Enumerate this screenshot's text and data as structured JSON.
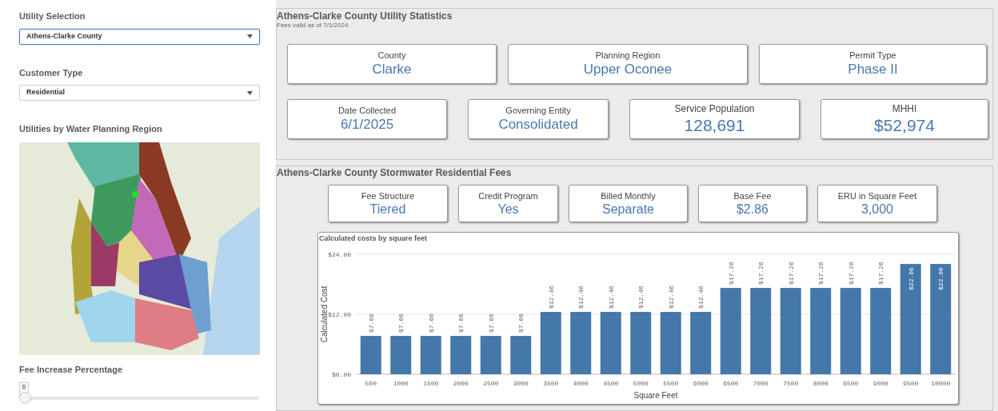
{
  "sidebar": {
    "filters": [
      {
        "label": "Utility Selection",
        "value": "Athens-Clarke County",
        "focused": true
      },
      {
        "label": "Customer Type",
        "value": "Residential",
        "focused": false
      }
    ],
    "map": {
      "title": "Utilities by Water Planning Region",
      "kind": "picture"
    },
    "slider": {
      "label": "Fee Increase Percentage",
      "value": "0",
      "level": 0
    }
  },
  "statistics": {
    "title": "Athens-Clarke County Utility Statistics",
    "subtitle": "Fees valid as of 7/1/2024",
    "rows": [
      [
        {
          "label": "County",
          "value": "Clarke",
          "kind": "normal"
        },
        {
          "label": "Planning Region",
          "value": "Upper Oconee",
          "kind": "normal"
        },
        {
          "label": "Permit Type",
          "value": "Phase II",
          "kind": "normal"
        }
      ],
      [
        {
          "label": "Date Collected",
          "value": "6/1/2025",
          "kind": "normal"
        },
        {
          "label": "Governing Entity",
          "value": "Consolidated",
          "kind": "normal"
        },
        {
          "label": "Service Population",
          "value": "128,691",
          "kind": "large"
        },
        {
          "label": "MHHI",
          "value": "$52,974",
          "kind": "large"
        }
      ]
    ]
  },
  "fees": {
    "title": "Athens-Clarke County Stormwater Residential Fees",
    "cards": [
      {
        "label": "Fee Structure",
        "value": "Tiered"
      },
      {
        "label": "Credit Program",
        "value": "Yes"
      },
      {
        "label": "Billed Monthly",
        "value": "Separate"
      },
      {
        "label": "Base Fee",
        "value": "$2.86"
      },
      {
        "label": "ERU in Square Feet",
        "value": "3,000"
      }
    ],
    "chart_data": {
      "type": "bar",
      "title": "Calculated costs by square feet",
      "xlabel": "Square Feet",
      "ylabel": "Calculated Cost",
      "categories": [
        "500",
        "1000",
        "1500",
        "2000",
        "2500",
        "3000",
        "3500",
        "4000",
        "4500",
        "5000",
        "5500",
        "6000",
        "6500",
        "7000",
        "7500",
        "8000",
        "8500",
        "9000",
        "9500",
        "10000"
      ],
      "series": [
        {
          "color": "#4477aa",
          "values": [
            7.66,
            7.66,
            7.66,
            7.66,
            7.66,
            7.66,
            12.46,
            12.46,
            12.46,
            12.46,
            12.46,
            12.46,
            17.26,
            17.26,
            17.26,
            17.26,
            17.26,
            17.26,
            22.06,
            22.06
          ]
        }
      ],
      "ylim": [
        0,
        24
      ],
      "yticks": [
        {
          "value": 0,
          "label": "$0.00"
        },
        {
          "value": 12,
          "label": "$12.00"
        },
        {
          "value": 24,
          "label": "$24.00"
        }
      ],
      "value_labels": [
        "$7.66",
        "$7.66",
        "$7.66",
        "$7.66",
        "$7.66",
        "$7.66",
        "$12.46",
        "$12.46",
        "$12.46",
        "$12.46",
        "$12.46",
        "$12.46",
        "$17.26",
        "$17.26",
        "$17.26",
        "$17.26",
        "$17.26",
        "$17.26",
        "$22.06",
        "$22.06"
      ]
    }
  }
}
